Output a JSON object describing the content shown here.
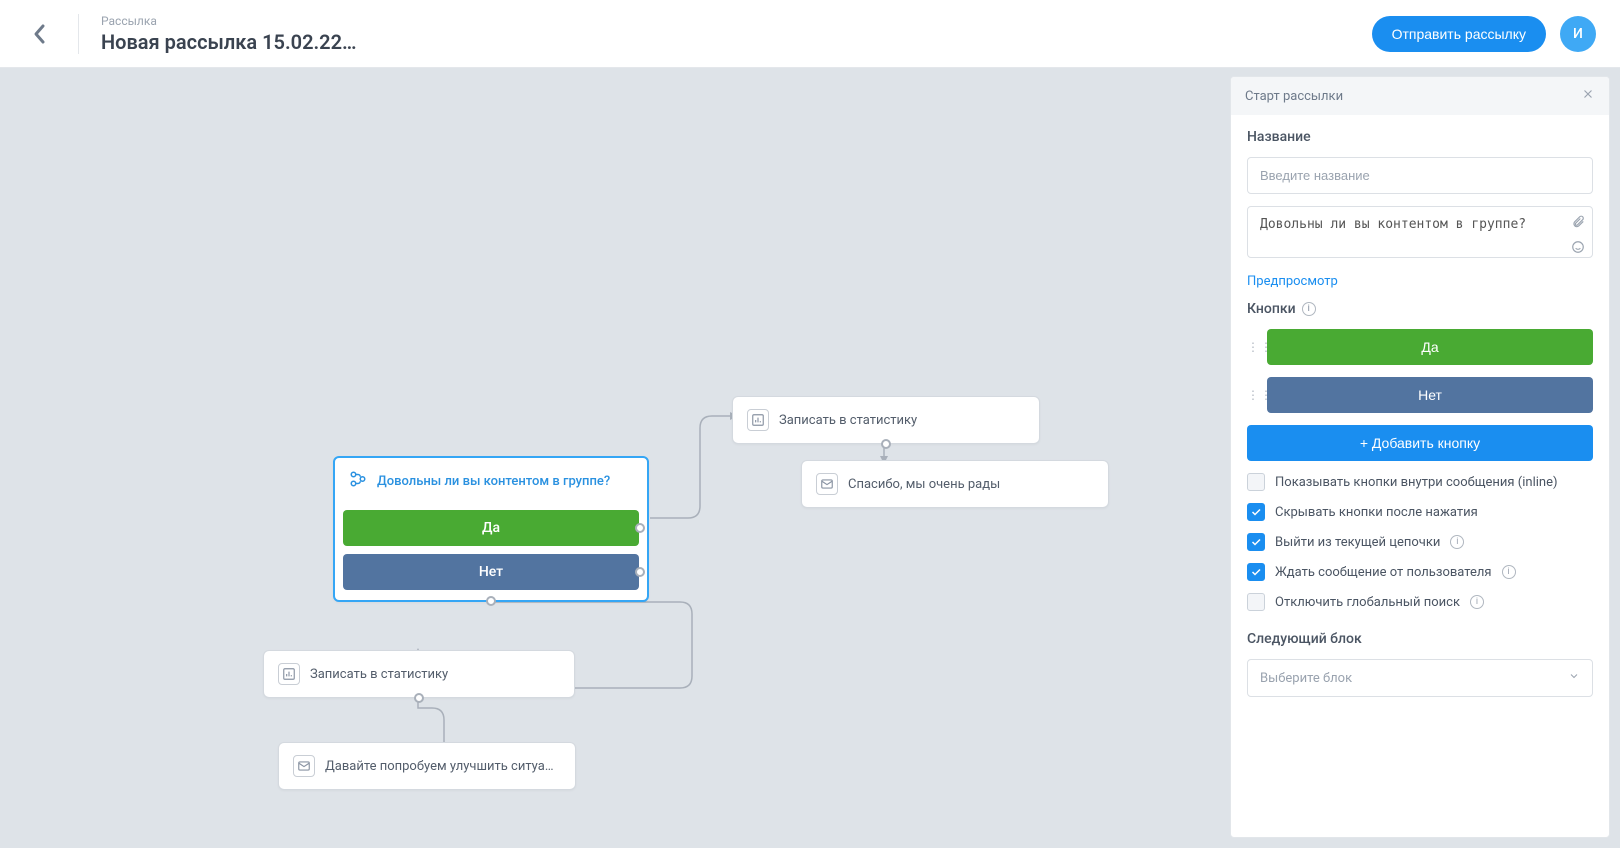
{
  "header": {
    "overline": "Рассылка",
    "title": "Новая рассылка 15.02.22…",
    "send_label": "Отправить рассылку",
    "avatar_letter": "И"
  },
  "canvas": {
    "start_node": {
      "question": "Довольны ли вы контентом в группе?",
      "yes": "Да",
      "no": "Нет"
    },
    "stats_node_1": "Записать в статистику",
    "thanks_node": "Спасибо, мы очень рады",
    "stats_node_2": "Записать в статистику",
    "improve_node": "Давайте попробуем улучшить ситуацию! Что…"
  },
  "panel": {
    "title": "Старт рассылки",
    "name_label": "Название",
    "name_placeholder": "Введите название",
    "message_value": "Довольны ли вы контентом в группе?",
    "preview_label": "Предпросмотр",
    "buttons_label": "Кнопки",
    "btn_yes": "Да",
    "btn_no": "Нет",
    "add_button_label": "+ Добавить кнопку",
    "opt_inline": "Показывать кнопки внутри сообщения (inline)",
    "opt_hide_after_click": "Скрывать кнопки после нажатия",
    "opt_exit_chain": "Выйти из текущей цепочки",
    "opt_wait_user": "Ждать сообщение от пользователя",
    "opt_disable_global": "Отключить глобальный поиск",
    "next_block_label": "Следующий блок",
    "next_block_placeholder": "Выберите блок"
  },
  "options_state": {
    "inline": false,
    "hide_after_click": true,
    "exit_chain": true,
    "wait_user": true,
    "disable_global": false
  }
}
